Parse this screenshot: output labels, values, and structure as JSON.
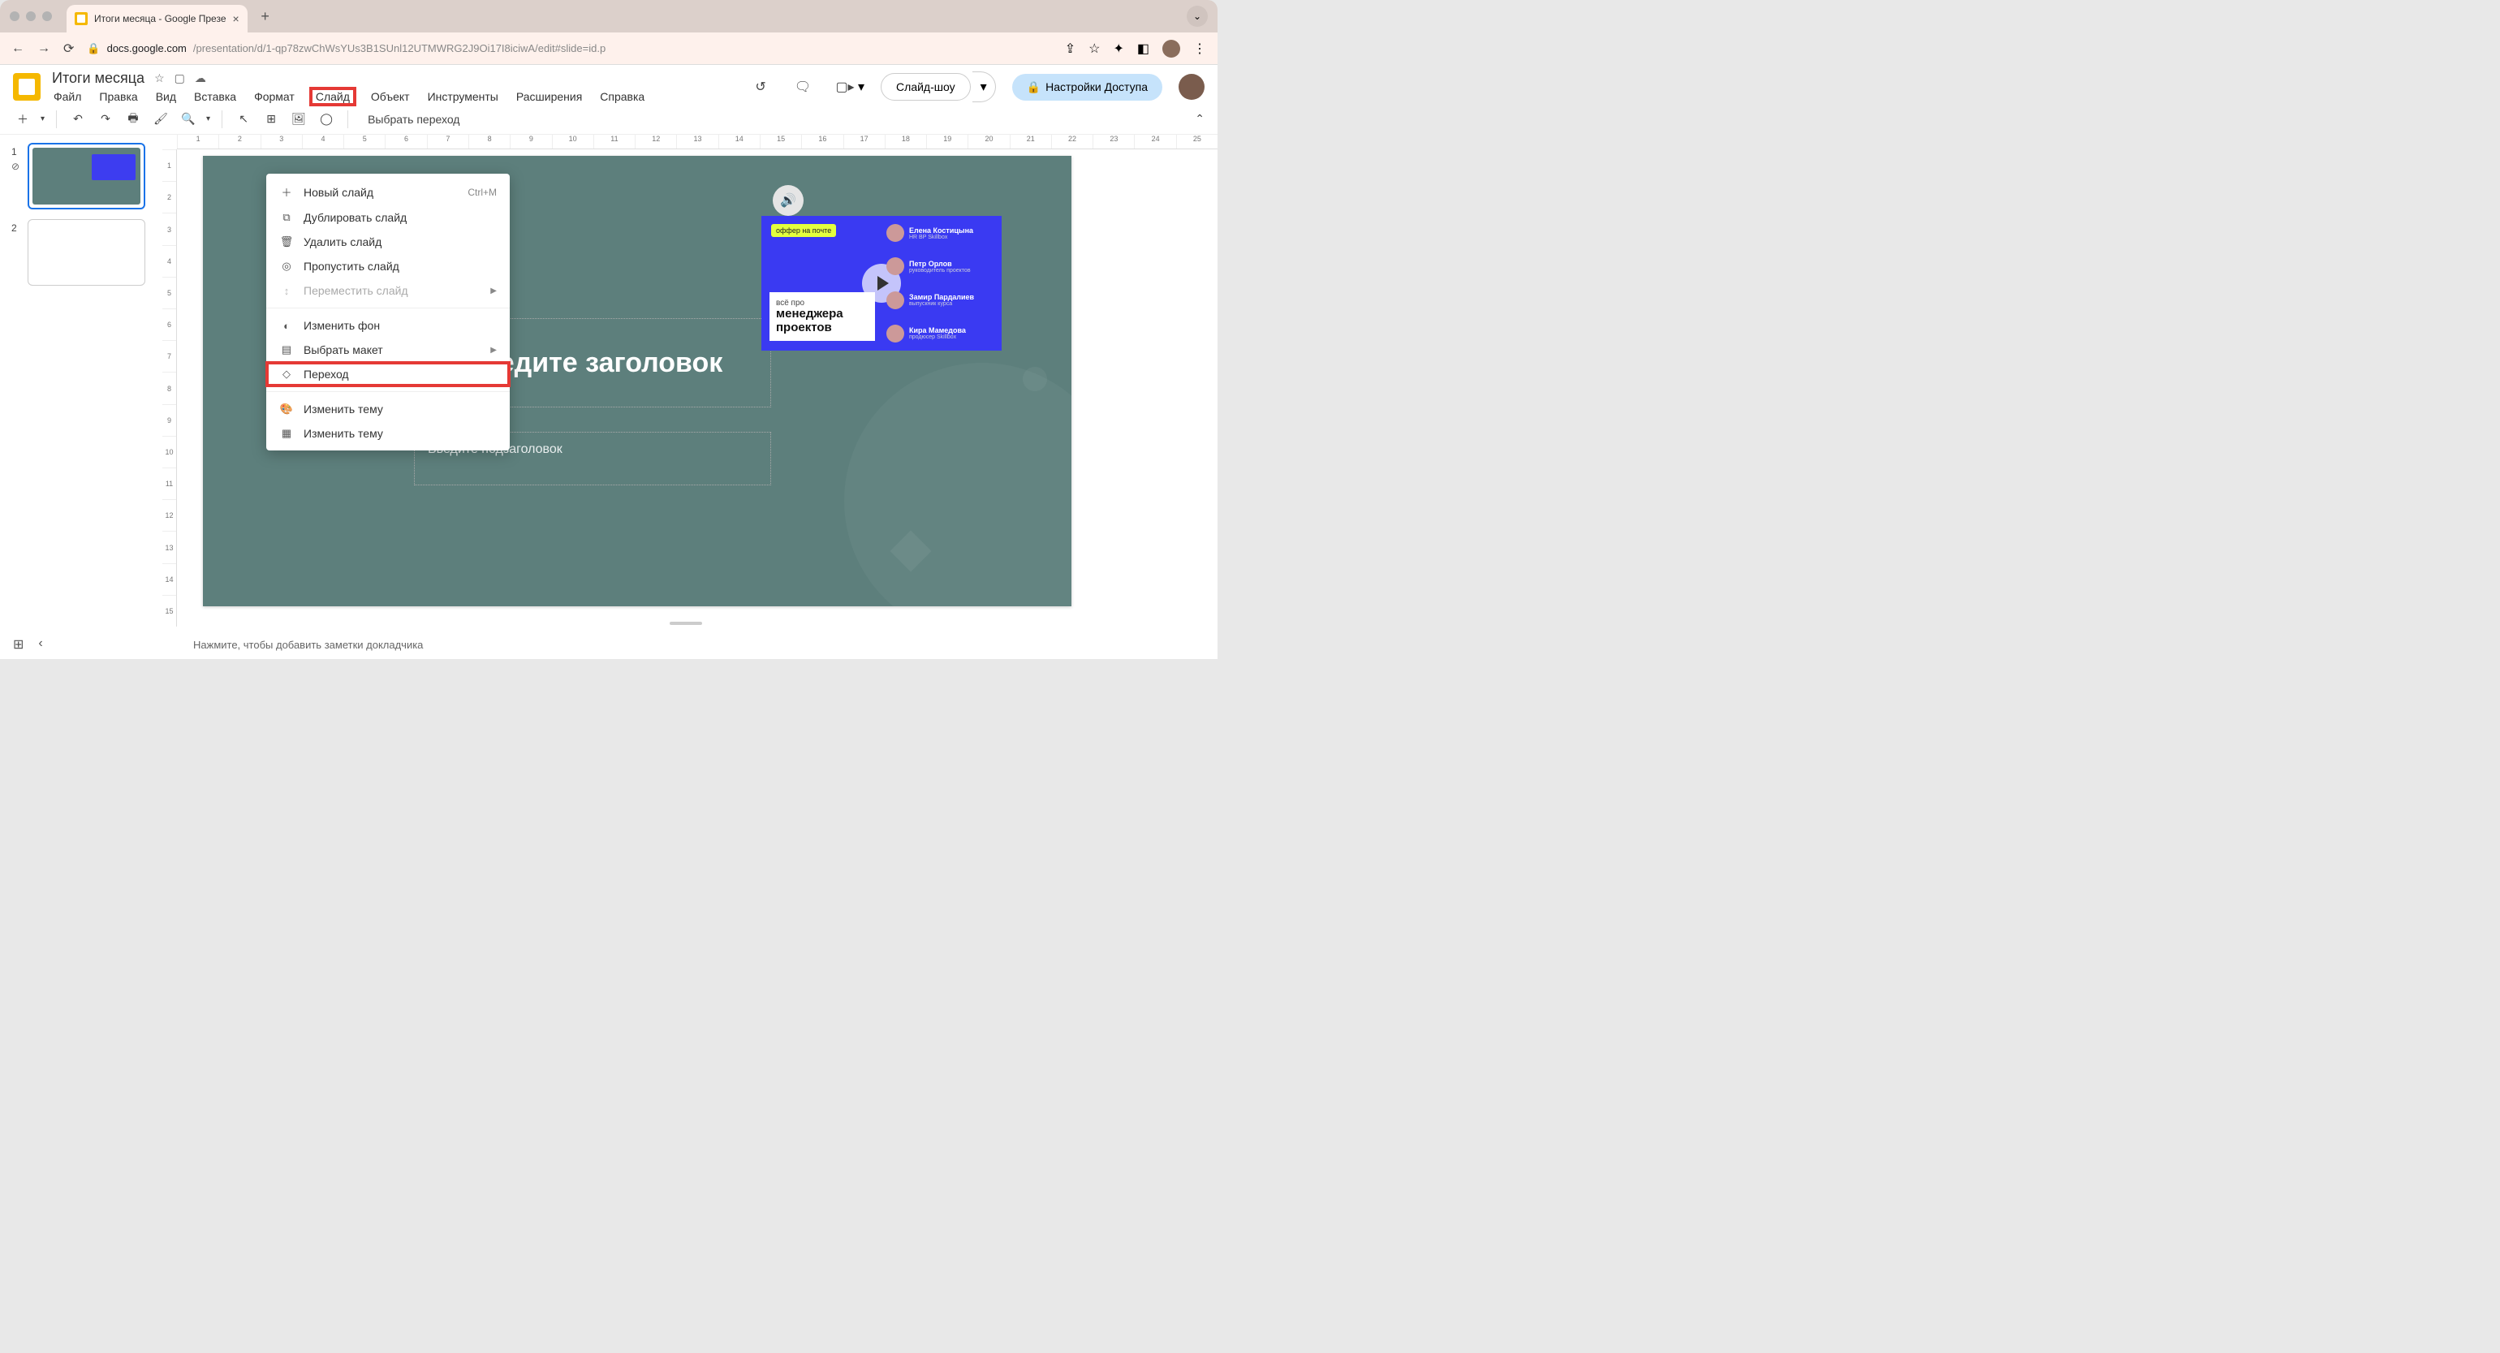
{
  "browser": {
    "tab_title": "Итоги месяца - Google Презе",
    "url_host": "docs.google.com",
    "url_path": "/presentation/d/1-qp78zwChWsYUs3B1SUnl12UTMWRG2J9Oi17I8iciwA/edit#slide=id.p"
  },
  "app": {
    "doc_title": "Итоги месяца",
    "menu": {
      "file": "Файл",
      "edit": "Правка",
      "view": "Вид",
      "insert": "Вставка",
      "format": "Формат",
      "slide": "Слайд",
      "object": "Объект",
      "tools": "Инструменты",
      "extensions": "Расширения",
      "help": "Справка"
    },
    "slideshow": "Слайд-шоу",
    "share": "Настройки Доступа",
    "transition_btn": "Выбрать переход"
  },
  "dropdown": {
    "new_slide": "Новый слайд",
    "new_slide_shortcut": "Ctrl+M",
    "duplicate": "Дублировать слайд",
    "delete": "Удалить слайд",
    "skip": "Пропустить слайд",
    "move": "Переместить слайд",
    "change_bg": "Изменить фон",
    "layout": "Выбрать макет",
    "transition": "Переход",
    "change_theme": "Изменить тему",
    "change_theme2": "Изменить тему"
  },
  "thumbs": {
    "n1": "1",
    "n2": "2"
  },
  "ruler_h": [
    "1",
    "2",
    "3",
    "4",
    "5",
    "6",
    "7",
    "8",
    "9",
    "10",
    "11",
    "12",
    "13",
    "14",
    "15",
    "16",
    "17",
    "18",
    "19",
    "20",
    "21",
    "22",
    "23",
    "24",
    "25"
  ],
  "ruler_v": [
    "1",
    "2",
    "3",
    "4",
    "5",
    "6",
    "7",
    "8",
    "9",
    "10",
    "11",
    "12",
    "13",
    "14",
    "15"
  ],
  "slide": {
    "title_placeholder": "Введите заголовок",
    "subtitle_placeholder": "Введите подзаголовок"
  },
  "video": {
    "badge": "оффер на почте",
    "small": "всё про",
    "big1": "менеджера",
    "big2": "проектов",
    "people": [
      {
        "name": "Елена Костицына",
        "role": "HR BP Skillbox"
      },
      {
        "name": "Петр Орлов",
        "role": "руководитель проектов"
      },
      {
        "name": "Замир Пардалиев",
        "role": "выпускник курса"
      },
      {
        "name": "Кира Мамедова",
        "role": "продюсер Skillbox"
      }
    ]
  },
  "notes": "Нажмите, чтобы добавить заметки докладчика"
}
